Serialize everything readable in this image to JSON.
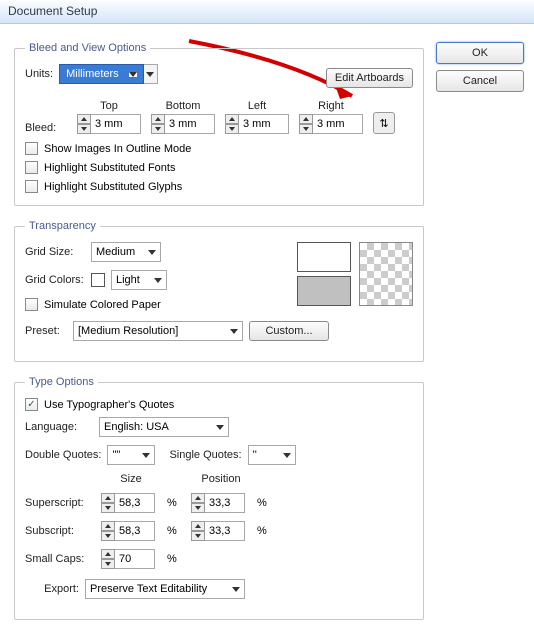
{
  "window": {
    "title": "Document Setup"
  },
  "buttons": {
    "ok": "OK",
    "cancel": "Cancel",
    "edit_artboards": "Edit Artboards",
    "custom": "Custom..."
  },
  "bleed": {
    "legend": "Bleed and View Options",
    "units_label": "Units:",
    "units_value": "Millimeters",
    "bleed_label": "Bleed:",
    "headers": {
      "top": "Top",
      "bottom": "Bottom",
      "left": "Left",
      "right": "Right"
    },
    "values": {
      "top": "3 mm",
      "bottom": "3 mm",
      "left": "3 mm",
      "right": "3 mm"
    },
    "cb1": "Show Images In Outline Mode",
    "cb2": "Highlight Substituted Fonts",
    "cb3": "Highlight Substituted Glyphs"
  },
  "transparency": {
    "legend": "Transparency",
    "grid_size_label": "Grid Size:",
    "grid_size_value": "Medium",
    "grid_colors_label": "Grid Colors:",
    "grid_colors_value": "Light",
    "simulate_label": "Simulate Colored Paper",
    "preset_label": "Preset:",
    "preset_value": "[Medium Resolution]"
  },
  "type": {
    "legend": "Type Options",
    "typographers": "Use Typographer's Quotes",
    "typographers_checked": true,
    "language_label": "Language:",
    "language_value": "English: USA",
    "double_quotes_label": "Double Quotes:",
    "double_quotes_value": "\"\"",
    "single_quotes_label": "Single Quotes:",
    "single_quotes_value": "''",
    "size_hdr": "Size",
    "pos_hdr": "Position",
    "superscript_label": "Superscript:",
    "superscript_size": "58,3",
    "superscript_pos": "33,3",
    "subscript_label": "Subscript:",
    "subscript_size": "58,3",
    "subscript_pos": "33,3",
    "smallcaps_label": "Small Caps:",
    "smallcaps_value": "70",
    "percent": "%",
    "export_label": "Export:",
    "export_value": "Preserve Text Editability"
  }
}
